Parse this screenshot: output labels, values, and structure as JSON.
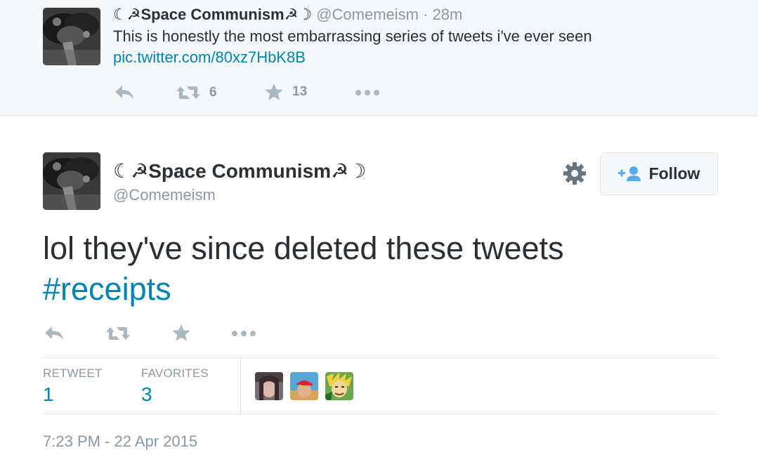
{
  "parent_tweet": {
    "name": "☾☭Space Communism☭☽",
    "handle": "@Comemeism",
    "separator": "·",
    "time": "28m",
    "text": "This is honestly the most embarrassing series of tweets i've ever seen",
    "link": "pic.twitter.com/80xz7HbK8B",
    "actions": {
      "reply_icon": "reply-icon",
      "retweet_icon": "retweet-icon",
      "retweet_count": "6",
      "favorite_icon": "star-icon",
      "favorite_count": "13",
      "more_icon": "more-dots-icon"
    }
  },
  "main_tweet": {
    "name": "☾☭Space Communism☭☽",
    "handle": "@Comemeism",
    "text": "lol they've since deleted these tweets",
    "hashtag": "#receipts",
    "settings_icon": "gear-icon",
    "follow_label": "Follow",
    "follow_icon": "add-user-icon",
    "actions": {
      "reply_icon": "reply-icon",
      "retweet_icon": "retweet-icon",
      "favorite_icon": "star-icon",
      "more_icon": "more-dots-icon"
    },
    "stats": {
      "retweet_label": "RETWEET",
      "retweet_count": "1",
      "favorites_label": "FAVORITES",
      "favorites_count": "3"
    },
    "favorited_by": [
      "user-avatar-1",
      "user-avatar-2",
      "user-avatar-3"
    ],
    "timestamp": "7:23 PM - 22 Apr 2015"
  },
  "colors": {
    "link": "#0084b4",
    "muted": "#8899a6",
    "text": "#292f33",
    "parent_bg": "#f5f8fa",
    "border": "#e1e8ed"
  }
}
